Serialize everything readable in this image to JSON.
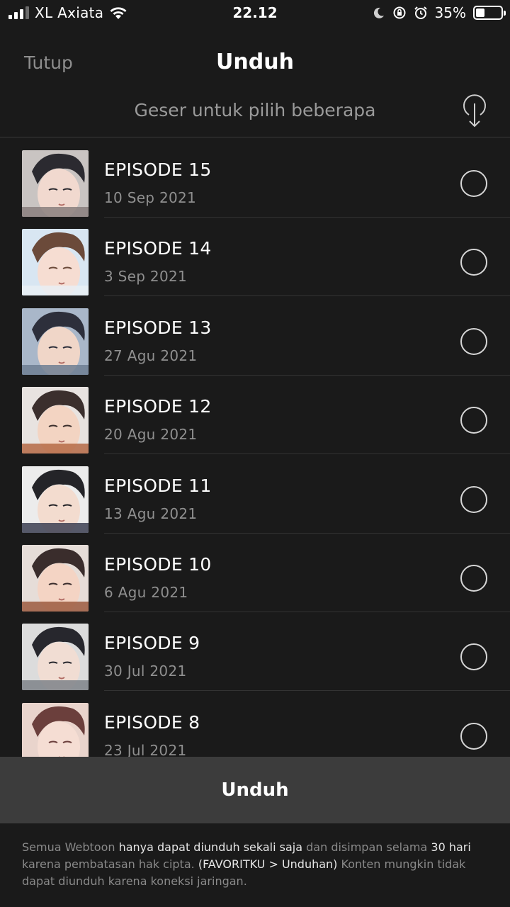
{
  "status_bar": {
    "carrier": "XL Axiata",
    "time": "22.12",
    "battery_percent": "35%",
    "battery_level": 0.35
  },
  "header": {
    "close_label": "Tutup",
    "title": "Unduh",
    "hint": "Geser untuk pilih beberapa"
  },
  "episodes": [
    {
      "title": "EPISODE 15",
      "date": "10 Sep 2021",
      "selected": false
    },
    {
      "title": "EPISODE 14",
      "date": "3 Sep 2021",
      "selected": false
    },
    {
      "title": "EPISODE 13",
      "date": "27 Agu 2021",
      "selected": false
    },
    {
      "title": "EPISODE 12",
      "date": "20 Agu 2021",
      "selected": false
    },
    {
      "title": "EPISODE 11",
      "date": "13 Agu 2021",
      "selected": false
    },
    {
      "title": "EPISODE 10",
      "date": "6 Agu 2021",
      "selected": false
    },
    {
      "title": "EPISODE 9",
      "date": "30 Jul 2021",
      "selected": false
    },
    {
      "title": "EPISODE 8",
      "date": "23 Jul 2021",
      "selected": false
    }
  ],
  "download_button": "Unduh",
  "footer": {
    "p1": "Semua Webtoon ",
    "p2": "hanya dapat diunduh sekali saja",
    "p3": " dan disimpan selama ",
    "p4": "30 hari",
    "p5": " karena pembatasan hak cipta. ",
    "p6": "(FAVORITKU > Unduhan)",
    "p7": " Konten mungkin tidak dapat diunduh karena koneksi jaringan."
  },
  "colors": {
    "background": "#1a1a1a",
    "button": "#3c3c3c",
    "muted_text": "#8f8f8f"
  }
}
